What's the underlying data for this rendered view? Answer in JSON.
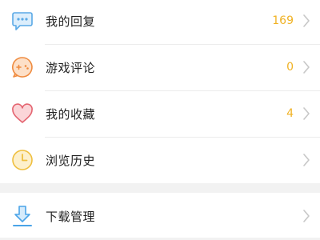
{
  "menu": {
    "items": [
      {
        "label": "我的回复",
        "count": "169",
        "icon": "chat-bubble-icon",
        "color": "#5aa9e6"
      },
      {
        "label": "游戏评论",
        "count": "0",
        "icon": "game-comment-icon",
        "color": "#ef8b3f"
      },
      {
        "label": "我的收藏",
        "count": "4",
        "icon": "heart-icon",
        "color": "#e46470"
      },
      {
        "label": "浏览历史",
        "count": "",
        "icon": "clock-icon",
        "color": "#efbf3f"
      },
      {
        "label": "下载管理",
        "count": "",
        "icon": "download-icon",
        "color": "#4aa4e8"
      }
    ]
  },
  "colors": {
    "count": "#f0b224",
    "label": "#222222",
    "chevron": "#c8c8c8",
    "section_gap": "#f2f2f2"
  }
}
